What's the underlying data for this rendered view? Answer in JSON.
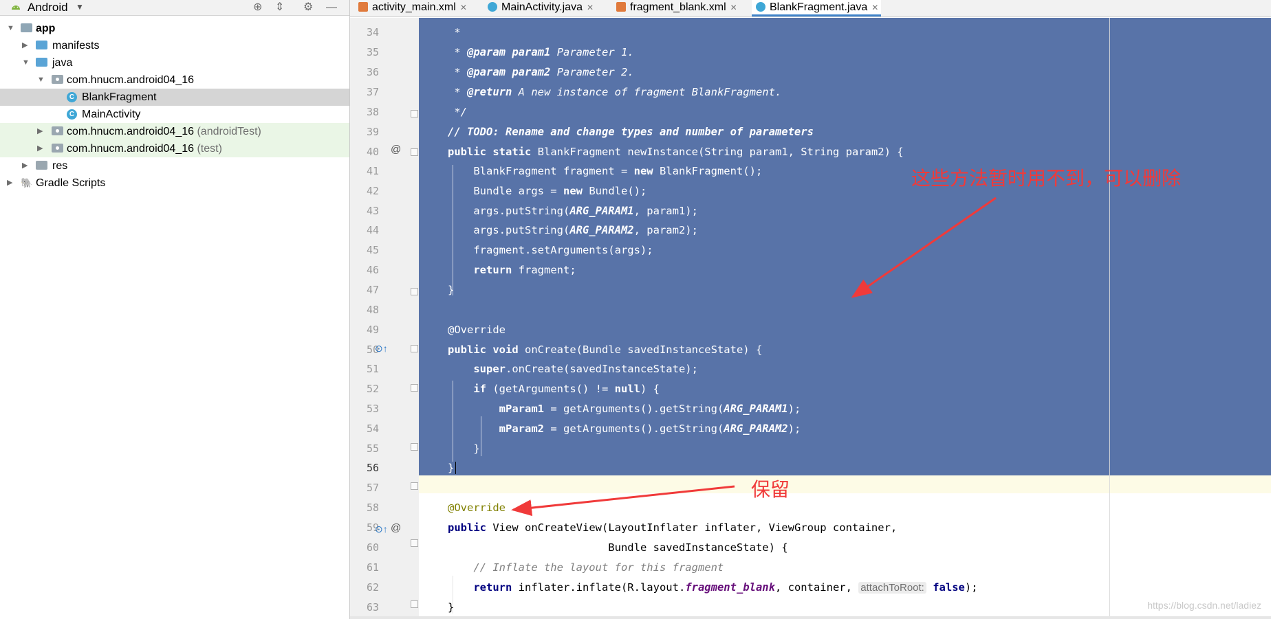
{
  "project_panel": {
    "view_label": "Android",
    "tree": [
      {
        "label": "app",
        "sub": ""
      },
      {
        "label": "manifests",
        "sub": ""
      },
      {
        "label": "java",
        "sub": ""
      },
      {
        "label": "com.hnucm.android04_16",
        "sub": ""
      },
      {
        "label": "BlankFragment",
        "sub": ""
      },
      {
        "label": "MainActivity",
        "sub": ""
      },
      {
        "label": "com.hnucm.android04_16",
        "sub": "(androidTest)"
      },
      {
        "label": "com.hnucm.android04_16",
        "sub": "(test)"
      },
      {
        "label": "res",
        "sub": ""
      },
      {
        "label": "Gradle Scripts",
        "sub": ""
      }
    ],
    "class_icon_letter": "C"
  },
  "tabs": [
    {
      "label": "activity_main.xml",
      "icon": "xml-file-icon"
    },
    {
      "label": "MainActivity.java",
      "icon": "java-class-icon"
    },
    {
      "label": "fragment_blank.xml",
      "icon": "xml-file-icon"
    },
    {
      "label": "BlankFragment.java",
      "icon": "java-class-icon"
    }
  ],
  "active_tab": "BlankFragment.java",
  "gutter": {
    "line_numbers": [
      "34",
      "35",
      "36",
      "37",
      "38",
      "39",
      "40",
      "41",
      "42",
      "43",
      "44",
      "45",
      "46",
      "47",
      "48",
      "49",
      "50",
      "51",
      "52",
      "53",
      "54",
      "55",
      "56",
      "57",
      "58",
      "59",
      "60",
      "61",
      "62",
      "63"
    ],
    "at_marker": "@",
    "current_line": "56"
  },
  "code": {
    "l34": " *",
    "l35_tag": "@param",
    "l35_name": "param1",
    "l35_rest": "Parameter 1.",
    "l36_tag": "@param",
    "l36_name": "param2",
    "l36_rest": "Parameter 2.",
    "l37_tag": "@return",
    "l37_rest": "A new instance of fragment BlankFragment.",
    "l38": " */",
    "l39": "// TODO: Rename and change types and number of parameters",
    "l40_kw": "public static",
    "l40_rest": "BlankFragment newInstance(String param1, String param2) {",
    "l41_a": "BlankFragment fragment =",
    "l41_kw": "new",
    "l41_b": "BlankFragment();",
    "l42_a": "Bundle args =",
    "l42_kw": "new",
    "l42_b": "Bundle();",
    "l43_a": "args.putString(",
    "l43_f": "ARG_PARAM1",
    "l43_b": ", param1);",
    "l44_a": "args.putString(",
    "l44_f": "ARG_PARAM2",
    "l44_b": ", param2);",
    "l45": "fragment.setArguments(args);",
    "l46_kw": "return",
    "l46_b": "fragment;",
    "l47": "}",
    "l49": "@Override",
    "l50_kw": "public void",
    "l50_rest": "onCreate(Bundle savedInstanceState) {",
    "l51_kw": "super",
    "l51_rest": ".onCreate(savedInstanceState);",
    "l52_kw": "if",
    "l52_a": "(getArguments() !=",
    "l52_kw2": "null",
    "l52_b": ") {",
    "l53_fld": "mParam1",
    "l53_a": "= getArguments().getString(",
    "l53_f": "ARG_PARAM1",
    "l53_b": ");",
    "l54_fld": "mParam2",
    "l54_a": "= getArguments().getString(",
    "l54_f": "ARG_PARAM2",
    "l54_b": ");",
    "l55": "}",
    "l56": "}",
    "l58": "@Override",
    "l59_kw": "public",
    "l59_rest": "View onCreateView(LayoutInflater inflater, ViewGroup container,",
    "l60": "Bundle savedInstanceState) {",
    "l61": "// Inflate the layout for this fragment",
    "l62_kw": "return",
    "l62_a": "inflater.inflate(R.layout.",
    "l62_f": "fragment_blank",
    "l62_b": ", container,",
    "l62_hint": "attachToRoot:",
    "l62_kw2": "false",
    "l62_c": ");",
    "l63": "}"
  },
  "annotations": {
    "delete_note": "这些方法暂时用不到，可以删除",
    "keep_note": "保留",
    "color": "#f03a3a"
  },
  "watermark": "https://blog.csdn.net/ladiez",
  "colors": {
    "selection": "#5873a8",
    "current_line": "#fdfbe6",
    "keyword": "#000080",
    "annotation": "#808000",
    "comment": "#808080",
    "field": "#660e7a"
  }
}
